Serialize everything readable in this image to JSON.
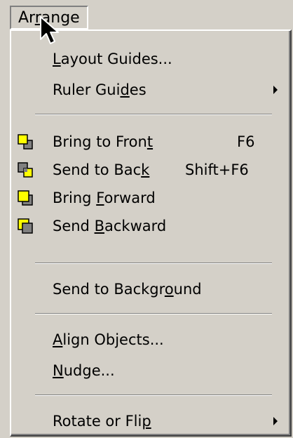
{
  "menu": {
    "title": {
      "before": "Ar",
      "underlined": "r",
      "after": "ange"
    }
  },
  "items": {
    "layout_guides": {
      "before": "",
      "underlined": "L",
      "after": "ayout Guides..."
    },
    "ruler_guides": {
      "before": "Ruler Gui",
      "underlined": "d",
      "after": "es"
    },
    "bring_to_front": {
      "before": "Bring to Fron",
      "underlined": "t",
      "after": "",
      "shortcut": "F6"
    },
    "send_to_back": {
      "before": "Send to Bac",
      "underlined": "k",
      "after": "",
      "shortcut": "Shift+F6"
    },
    "bring_forward": {
      "before": "Bring ",
      "underlined": "F",
      "after": "orward"
    },
    "send_backward": {
      "before": "Send ",
      "underlined": "B",
      "after": "ackward"
    },
    "send_to_background": {
      "before": "Send to Backgr",
      "underlined": "o",
      "after": "und"
    },
    "align_objects": {
      "before": "",
      "underlined": "A",
      "after": "lign Objects..."
    },
    "nudge": {
      "before": "",
      "underlined": "N",
      "after": "udge..."
    },
    "rotate_or_flip": {
      "before": "Rotate or Fli",
      "underlined": "p",
      "after": ""
    }
  },
  "icons": {
    "bring_to_front": "bring-to-front-icon",
    "send_to_back": "send-to-back-icon",
    "bring_forward": "bring-forward-icon",
    "send_backward": "send-backward-icon",
    "submenu": "submenu-arrow-icon",
    "cursor": "mouse-pointer-icon"
  },
  "colors": {
    "menu_bg": "#d4d0c8",
    "icon_yellow": "#ffff00",
    "icon_gray": "#808080"
  }
}
